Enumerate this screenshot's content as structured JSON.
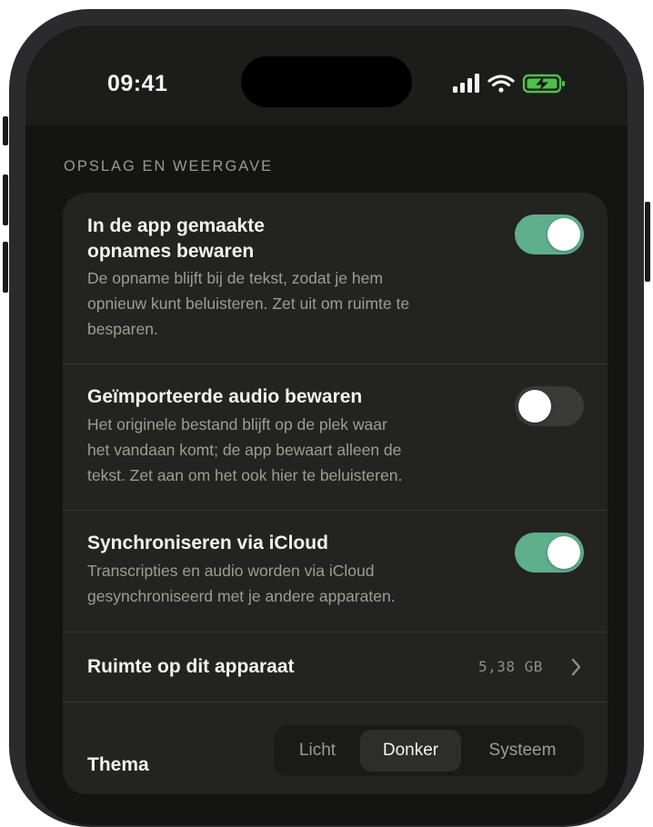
{
  "status_bar": {
    "time": "09:41"
  },
  "section": {
    "title": "OPSLAG EN WEERGAVE"
  },
  "settings": {
    "save_recordings": {
      "title_line1": "In de app gemaakte",
      "title_line2": "opnames bewaren",
      "desc_line1": "De opname blijft bij de tekst, zodat je hem",
      "desc_line2": "opnieuw kunt beluisteren. Zet uit om ruimte te",
      "desc_line3": "besparen.",
      "enabled": true
    },
    "save_imported": {
      "title": "Geïmporteerde audio bewaren",
      "desc_line1": "Het originele bestand blijft op de plek waar",
      "desc_line2": "het vandaan komt; de app bewaart alleen de",
      "desc_line3": "tekst. Zet aan om het ook hier te beluisteren.",
      "enabled": false
    },
    "icloud_sync": {
      "title": "Synchroniseren via iCloud",
      "desc_line1": "Transcripties en audio worden via iCloud",
      "desc_line2": "gesynchroniseerd met je andere apparaten.",
      "enabled": true
    },
    "storage": {
      "title": "Ruimte op dit apparaat",
      "value": "5,38 GB"
    },
    "theme": {
      "title": "Thema",
      "options": [
        "Licht",
        "Donker",
        "Systeem"
      ],
      "selected": "Donker"
    }
  },
  "colors": {
    "toggle_on": "#5fae8c",
    "toggle_off": "#3a3a38",
    "battery": "#4fc14a"
  }
}
